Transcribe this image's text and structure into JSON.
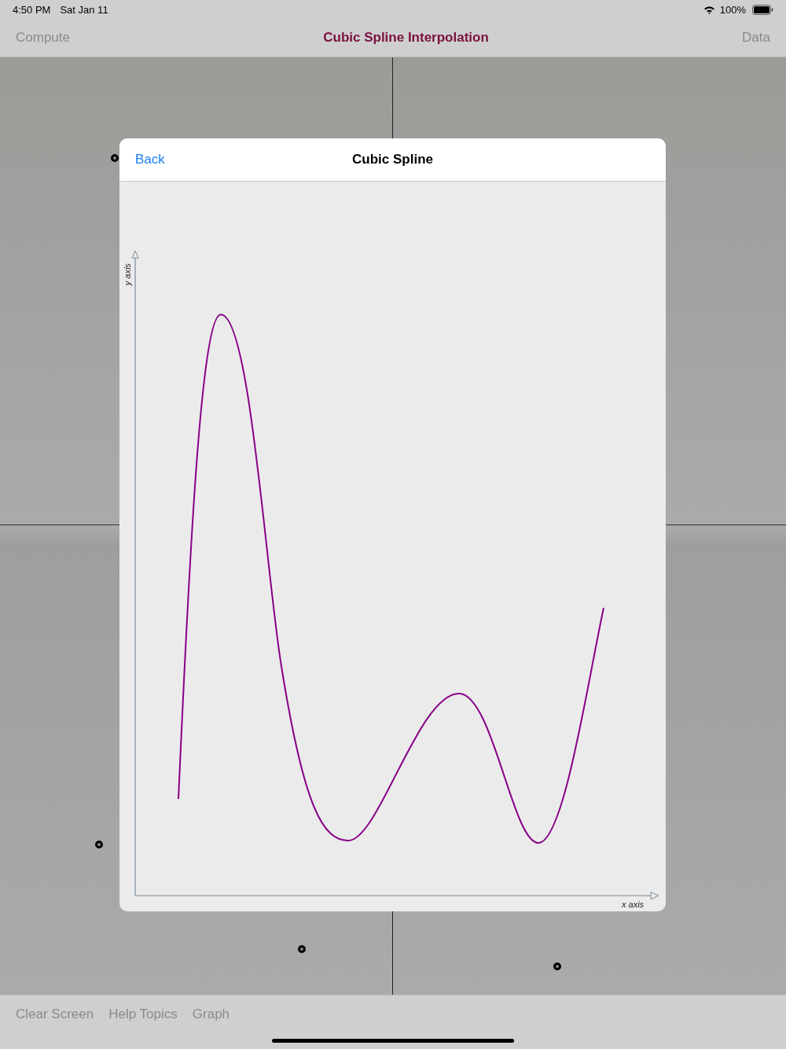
{
  "status_bar": {
    "time": "4:50 PM",
    "date": "Sat Jan 11",
    "battery": "100%"
  },
  "nav_bar": {
    "left_button": "Compute",
    "title": "Cubic Spline Interpolation",
    "right_button": "Data"
  },
  "dialog": {
    "back": "Back",
    "title": "Cubic Spline",
    "graph": {
      "xlabel": "x axis",
      "ylabel": "y axis"
    }
  },
  "toolbar": [
    "Clear Screen",
    "Help Topics",
    "Graph"
  ]
}
